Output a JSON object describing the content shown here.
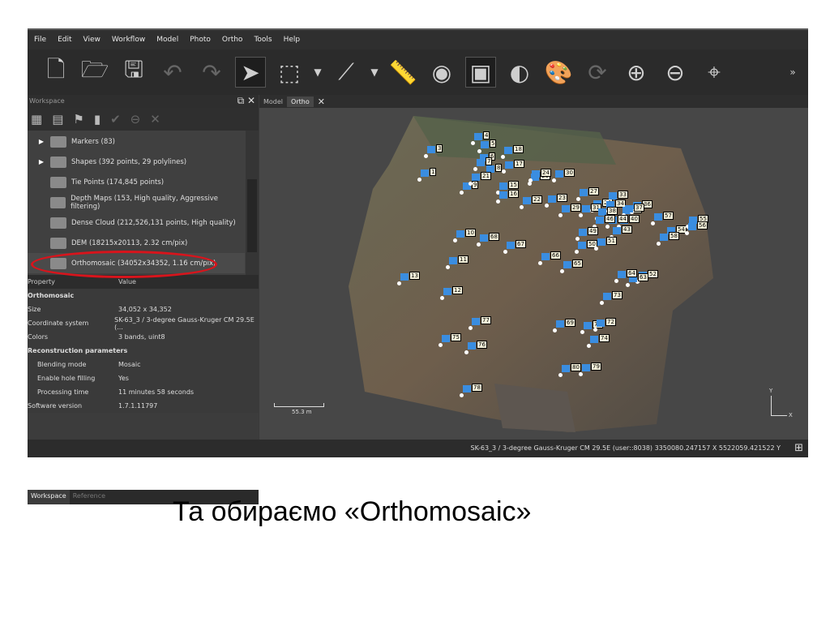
{
  "menu": [
    "File",
    "Edit",
    "View",
    "Workflow",
    "Model",
    "Photo",
    "Ortho",
    "Tools",
    "Help"
  ],
  "toolbar": {
    "icons": [
      "new-file",
      "open-folder",
      "save",
      "undo",
      "redo",
      "pointer",
      "rectangle-select",
      "select-dropdown",
      "ruler-tool",
      "dropdown",
      "ruler",
      "dem",
      "orthomosaic",
      "contrast",
      "palette",
      "refresh",
      "zoom-in",
      "zoom-out",
      "fit-view",
      "more"
    ],
    "more": "»"
  },
  "workspace": {
    "title": "Workspace",
    "tools": [
      "add-chunk",
      "add-photos",
      "add-marker",
      "add-scalebar",
      "enable",
      "disable",
      "remove"
    ],
    "items": [
      {
        "label": "Markers (83)",
        "expandable": true
      },
      {
        "label": "Shapes (392 points, 29 polylines)",
        "expandable": true
      },
      {
        "label": "Tie Points (174,845 points)"
      },
      {
        "label": "Depth Maps (153, High quality, Aggressive filtering)"
      },
      {
        "label": "Dense Cloud (212,526,131 points, High quality)"
      },
      {
        "label": "DEM (18215x20113, 2.32 cm/pix)"
      },
      {
        "label": "Orthomosaic (34052x34352, 1.16 cm/pix)",
        "selected": true
      }
    ],
    "props_header": {
      "property": "Property",
      "value": "Value"
    },
    "props": [
      {
        "k": "Orthomosaic",
        "v": "",
        "section": true
      },
      {
        "k": "Size",
        "v": "34,052 x 34,352"
      },
      {
        "k": "Coordinate system",
        "v": "SK-63_3 / 3-degree Gauss-Kruger CM 29.5E (..."
      },
      {
        "k": "Colors",
        "v": "3 bands, uint8"
      },
      {
        "k": "Reconstruction parameters",
        "v": "",
        "section": true
      },
      {
        "k": "Blending mode",
        "v": "Mosaic",
        "indent": true
      },
      {
        "k": "Enable hole filling",
        "v": "Yes",
        "indent": true
      },
      {
        "k": "Processing time",
        "v": "11 minutes 58 seconds",
        "indent": true
      },
      {
        "k": "Software version",
        "v": "1.7.1.11797"
      }
    ],
    "tabs": [
      "Workspace",
      "Reference"
    ]
  },
  "view": {
    "tabs": [
      "Model",
      "Ortho"
    ],
    "active_tab": "Ortho",
    "scale": "55.3 m",
    "axis_x": "X",
    "axis_y": "Y",
    "markers": [
      "1",
      "3",
      "4",
      "5",
      "6",
      "7",
      "8",
      "9",
      "10",
      "11",
      "12",
      "13",
      "15",
      "16",
      "17",
      "18",
      "20",
      "21",
      "22",
      "23",
      "24",
      "27",
      "28",
      "29",
      "30",
      "31",
      "33",
      "34",
      "35",
      "36",
      "37",
      "38",
      "40",
      "43",
      "44",
      "46",
      "49",
      "50",
      "51",
      "52",
      "54",
      "55",
      "56",
      "57",
      "58",
      "63",
      "64",
      "65",
      "66",
      "67",
      "68",
      "69",
      "70",
      "72",
      "73",
      "74",
      "75",
      "76",
      "77",
      "78",
      "79",
      "80"
    ]
  },
  "status": {
    "text": "SK-63_3 / 3-degree Gauss-Kruger CM 29.5E (user::8038)  3350080.247157 X  5522059.421522 Y"
  },
  "caption": "Та обираємо «Orthomosaic»",
  "colors": {
    "highlight": "#d8141c",
    "marker": "#3a8de0"
  }
}
